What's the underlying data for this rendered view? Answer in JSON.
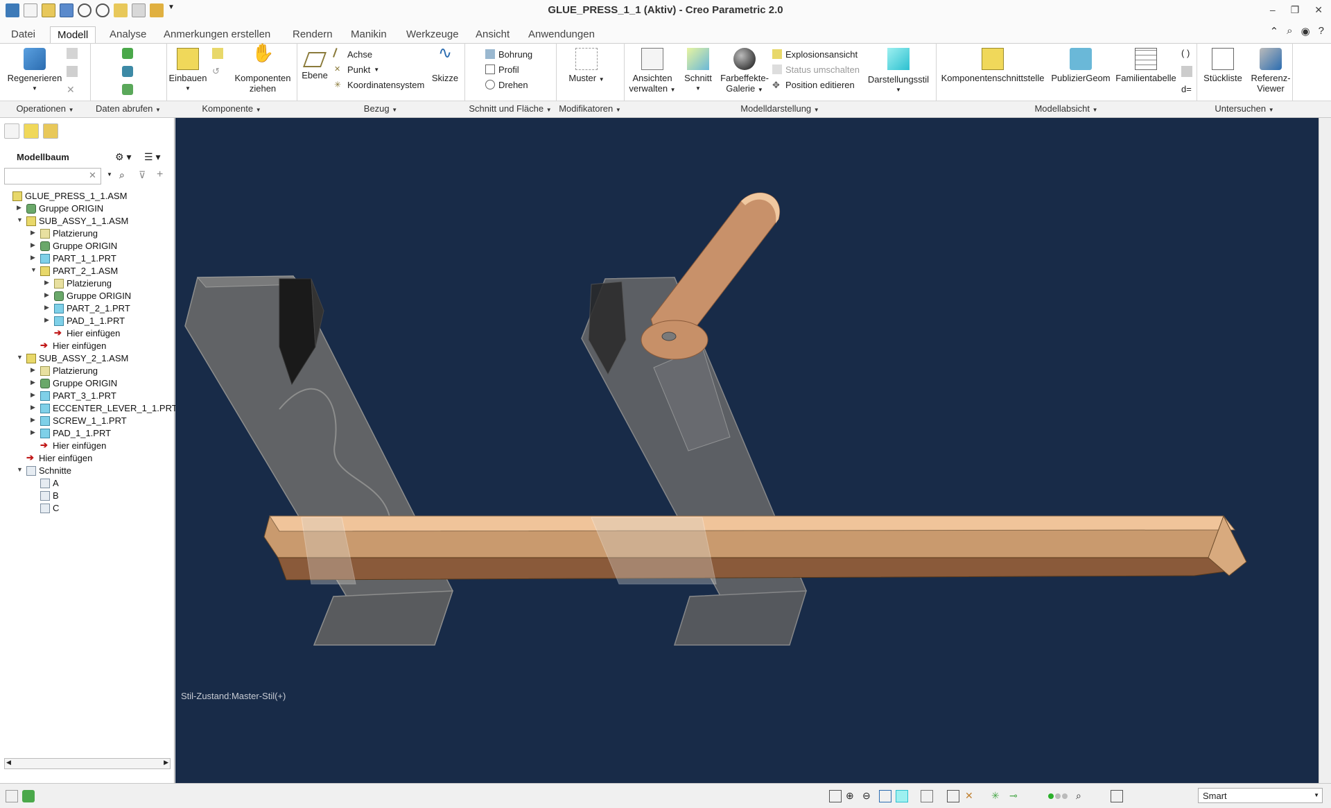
{
  "window": {
    "title": "GLUE_PRESS_1_1 (Aktiv) - Creo Parametric 2.0"
  },
  "tabs": [
    {
      "label": "Datei"
    },
    {
      "label": "Modell"
    },
    {
      "label": "Analyse"
    },
    {
      "label": "Anmerkungen erstellen"
    },
    {
      "label": "Rendern"
    },
    {
      "label": "Manikin"
    },
    {
      "label": "Werkzeuge"
    },
    {
      "label": "Ansicht"
    },
    {
      "label": "Anwendungen"
    }
  ],
  "ribbon": {
    "regenerieren": "Regenerieren",
    "einbauen": "Einbauen",
    "komponenten_ziehen": [
      "Komponenten",
      "ziehen"
    ],
    "ebene": "Ebene",
    "achse": "Achse",
    "punkt": "Punkt",
    "koordinatensystem": "Koordinatensystem",
    "skizze": "Skizze",
    "bohrung": "Bohrung",
    "profil": "Profil",
    "drehen": "Drehen",
    "muster": "Muster",
    "ansichten_verwalten": [
      "Ansichten",
      "verwalten"
    ],
    "schnitt": "Schnitt",
    "farbeffekte_galerie": [
      "Farbeffekte-",
      "Galerie"
    ],
    "explosionsansicht": "Explosionsansicht",
    "status_umschalten": "Status umschalten",
    "position_editieren": "Position editieren",
    "darstellungsstil": "Darstellungsstil",
    "komponentenschnittstelle": "Komponentenschnittstelle",
    "publiziergeom": "PublizierGeom",
    "familientabelle": "Familientabelle",
    "stueckliste": "Stückliste",
    "referenz_viewer": [
      "Referenz-",
      "Viewer"
    ]
  },
  "groups": [
    {
      "label": "Operationen"
    },
    {
      "label": "Daten abrufen"
    },
    {
      "label": "Komponente"
    },
    {
      "label": "Bezug"
    },
    {
      "label": "Schnitt und Fläche"
    },
    {
      "label": "Modifikatoren"
    },
    {
      "label": "Modelldarstellung"
    },
    {
      "label": "Modellabsicht"
    },
    {
      "label": "Untersuchen"
    }
  ],
  "left_panel": {
    "title": "Modellbaum",
    "search_value": ""
  },
  "tree": [
    {
      "label": "GLUE_PRESS_1_1.ASM",
      "level": 0,
      "icon": "asm",
      "expand": ""
    },
    {
      "label": "Gruppe ORIGIN",
      "level": 1,
      "icon": "grp",
      "expand": "▶"
    },
    {
      "label": "SUB_ASSY_1_1.ASM",
      "level": 1,
      "icon": "asm",
      "expand": "▼"
    },
    {
      "label": "Platzierung",
      "level": 2,
      "icon": "plc",
      "expand": "▶"
    },
    {
      "label": "Gruppe ORIGIN",
      "level": 2,
      "icon": "grp",
      "expand": "▶"
    },
    {
      "label": "PART_1_1.PRT",
      "level": 2,
      "icon": "prt",
      "expand": "▶"
    },
    {
      "label": "PART_2_1.ASM",
      "level": 2,
      "icon": "asm",
      "expand": "▼"
    },
    {
      "label": "Platzierung",
      "level": 3,
      "icon": "plc",
      "expand": "▶"
    },
    {
      "label": "Gruppe ORIGIN",
      "level": 3,
      "icon": "grp",
      "expand": "▶"
    },
    {
      "label": "PART_2_1.PRT",
      "level": 3,
      "icon": "prt",
      "expand": "▶"
    },
    {
      "label": "PAD_1_1.PRT",
      "level": 3,
      "icon": "prt",
      "expand": "▶"
    },
    {
      "label": "Hier einfügen",
      "level": 3,
      "icon": "ins",
      "expand": ""
    },
    {
      "label": "Hier einfügen",
      "level": 2,
      "icon": "ins",
      "expand": ""
    },
    {
      "label": "SUB_ASSY_2_1.ASM",
      "level": 1,
      "icon": "asm",
      "expand": "▼"
    },
    {
      "label": "Platzierung",
      "level": 2,
      "icon": "plc",
      "expand": "▶"
    },
    {
      "label": "Gruppe ORIGIN",
      "level": 2,
      "icon": "grp",
      "expand": "▶"
    },
    {
      "label": "PART_3_1.PRT",
      "level": 2,
      "icon": "prt",
      "expand": "▶"
    },
    {
      "label": "ECCENTER_LEVER_1_1.PRT",
      "level": 2,
      "icon": "prt",
      "expand": "▶"
    },
    {
      "label": "SCREW_1_1.PRT",
      "level": 2,
      "icon": "prt",
      "expand": "▶"
    },
    {
      "label": "PAD_1_1.PRT",
      "level": 2,
      "icon": "prt",
      "expand": "▶"
    },
    {
      "label": "Hier einfügen",
      "level": 2,
      "icon": "ins",
      "expand": ""
    },
    {
      "label": "Hier einfügen",
      "level": 1,
      "icon": "ins",
      "expand": ""
    },
    {
      "label": "Schnitte",
      "level": 1,
      "icon": "sec",
      "expand": "▼"
    },
    {
      "label": "A",
      "level": 2,
      "icon": "sec",
      "expand": ""
    },
    {
      "label": "B",
      "level": 2,
      "icon": "sec",
      "expand": ""
    },
    {
      "label": "C",
      "level": 2,
      "icon": "sec",
      "expand": ""
    }
  ],
  "viewport": {
    "background": "#182b48",
    "style_state": "Stil-Zustand:Master-Stil(+)"
  },
  "statusbar": {
    "filter_value": "Smart"
  },
  "colors": {
    "wood": "#e8b888",
    "glass": "#8a8a86",
    "accent": "#2b6cb0"
  }
}
